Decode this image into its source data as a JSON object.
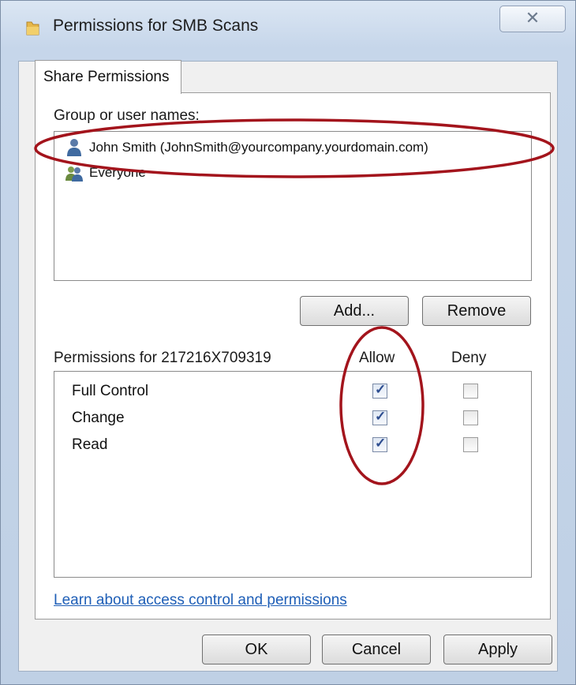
{
  "window": {
    "title": "Permissions for SMB Scans",
    "close_glyph": "✕"
  },
  "tab": {
    "label": "Share Permissions"
  },
  "groups": {
    "label": "Group or user names:",
    "items": [
      {
        "name": "John Smith (JohnSmith@yourcompany.yourdomain.com)",
        "icon": "user-icon"
      },
      {
        "name": "Everyone",
        "icon": "users-group-icon"
      }
    ]
  },
  "buttons": {
    "add": "Add...",
    "remove": "Remove",
    "ok": "OK",
    "cancel": "Cancel",
    "apply": "Apply"
  },
  "permissions": {
    "header": "Permissions for 217216X709319",
    "allow_label": "Allow",
    "deny_label": "Deny",
    "rows": [
      {
        "name": "Full Control",
        "allow": true,
        "deny": false
      },
      {
        "name": "Change",
        "allow": true,
        "deny": false
      },
      {
        "name": "Read",
        "allow": true,
        "deny": false
      }
    ]
  },
  "link": {
    "text": "Learn about access control and permissions"
  },
  "colors": {
    "annotation": "#a3141c",
    "link": "#1f5fb7"
  }
}
